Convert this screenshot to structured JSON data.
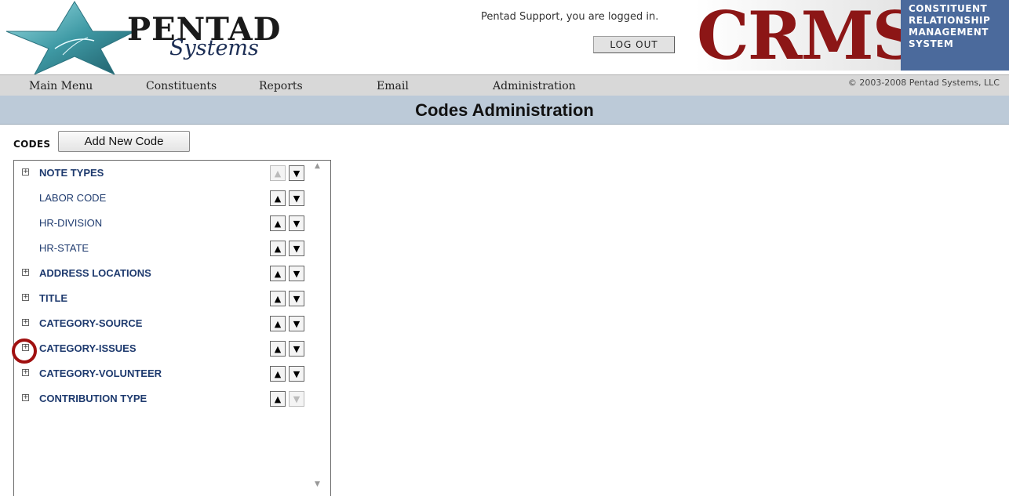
{
  "brand": {
    "name_top": "PENTAD",
    "name_bottom": "Systems",
    "product": "CRMS",
    "product_side": [
      "CONSTITUENT",
      "RELATIONSHIP",
      "MANAGEMENT",
      "SYSTEM"
    ]
  },
  "session": {
    "login_message": "Pentad Support, you are logged in.",
    "logout_label": "LOG OUT"
  },
  "nav": {
    "items": [
      "Main Menu",
      "Constituents",
      "Reports",
      "Email",
      "Administration"
    ],
    "copyright": "© 2003-2008 Pentad Systems, LLC"
  },
  "page": {
    "title": "Codes Administration",
    "codes_label": "CODES",
    "add_button": "Add New Code"
  },
  "codes": [
    {
      "label": "NOTE TYPES",
      "expandable": true,
      "up_enabled": false,
      "down_enabled": true
    },
    {
      "label": "LABOR CODE",
      "expandable": false,
      "up_enabled": true,
      "down_enabled": true
    },
    {
      "label": "HR-DIVISION",
      "expandable": false,
      "up_enabled": true,
      "down_enabled": true
    },
    {
      "label": "HR-STATE",
      "expandable": false,
      "up_enabled": true,
      "down_enabled": true
    },
    {
      "label": "ADDRESS LOCATIONS",
      "expandable": true,
      "up_enabled": true,
      "down_enabled": true
    },
    {
      "label": "TITLE",
      "expandable": true,
      "up_enabled": true,
      "down_enabled": true
    },
    {
      "label": "CATEGORY-SOURCE",
      "expandable": true,
      "up_enabled": true,
      "down_enabled": true
    },
    {
      "label": "CATEGORY-ISSUES",
      "expandable": true,
      "up_enabled": true,
      "down_enabled": true,
      "highlighted": true
    },
    {
      "label": "CATEGORY-VOLUNTEER",
      "expandable": true,
      "up_enabled": true,
      "down_enabled": true
    },
    {
      "label": "CONTRIBUTION TYPE",
      "expandable": true,
      "up_enabled": true,
      "down_enabled": false
    }
  ],
  "colors": {
    "crms_red": "#8c1616",
    "side_blue": "#4b6a9c",
    "code_text": "#1e3a6e",
    "title_bar": "#bccad8",
    "highlight_ring": "#a01010"
  }
}
